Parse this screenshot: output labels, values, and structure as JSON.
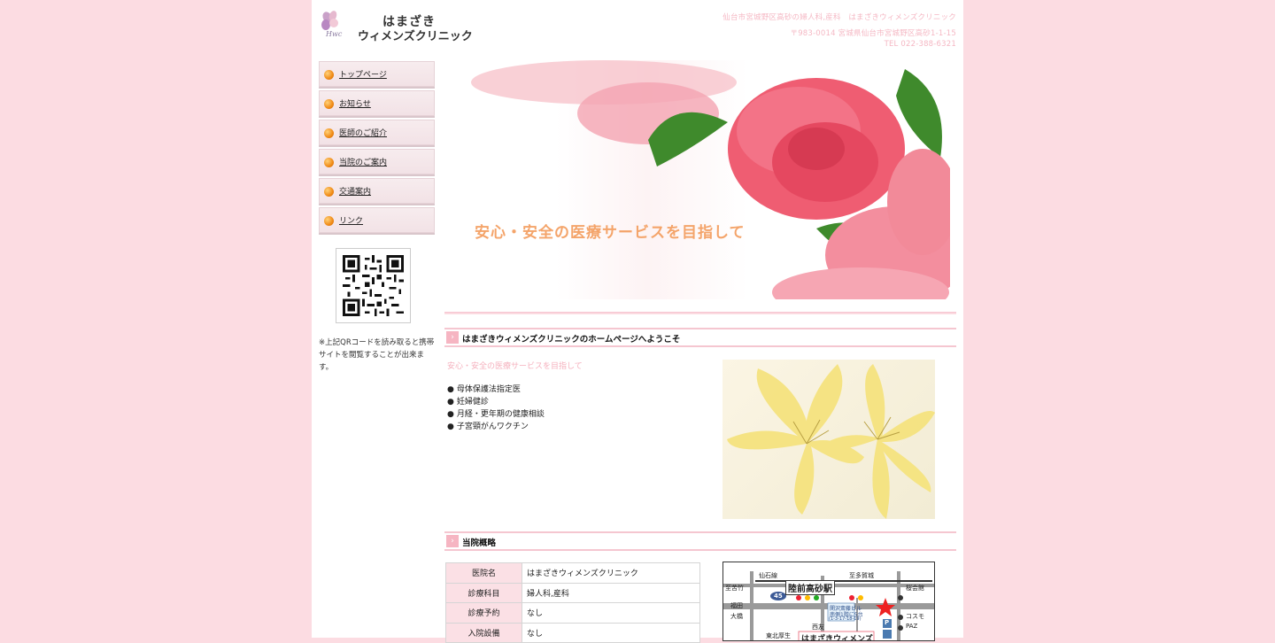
{
  "header": {
    "logo_line1": "はまざき",
    "logo_line2": "ウィメンズクリニック",
    "logo_script": "Hwc",
    "tagline": "仙台市宮城野区高砂の婦人科,産科　はまざきウィメンズクリニック",
    "address": "〒983-0014 宮城県仙台市宮城野区高砂1-1-15",
    "tel": "TEL 022-388-6321"
  },
  "nav": {
    "items": [
      {
        "label": "トップページ"
      },
      {
        "label": "お知らせ"
      },
      {
        "label": "医師のご紹介"
      },
      {
        "label": "当院のご案内"
      },
      {
        "label": "交通案内"
      },
      {
        "label": "リンク"
      }
    ]
  },
  "sidebar": {
    "qr_note": "※上記QRコードを読み取ると携帯サイトを閲覧することが出来ます。"
  },
  "hero": {
    "text": "安心・安全の医療サービスを目指して"
  },
  "welcome": {
    "title": "はまざきウィメンズクリニックのホームページへようこそ",
    "lead": "安心・安全の医療サービスを目指して",
    "bullet": "●",
    "services": [
      "母体保護法指定医",
      "妊婦健診",
      "月経・更年期の健康相談",
      "子宮頸がんワクチン"
    ]
  },
  "overview": {
    "title": "当院概略",
    "rows": [
      {
        "key": "医院名",
        "value": "はまざきウィメンズクリニック"
      },
      {
        "key": "診療科目",
        "value": "婦人科,産科"
      },
      {
        "key": "診療予約",
        "value": "なし"
      },
      {
        "key": "入院設備",
        "value": "なし"
      }
    ]
  },
  "map": {
    "line_label": "仙石線",
    "station": "陸前高砂駅",
    "to_tagajo": "至多賀城",
    "to_shiogama": "至苦竹",
    "fukuda": "福田",
    "ohashi": "大橋",
    "route": "45",
    "building": "関沢斎藤ビル",
    "building_sub": "南側1階に5台",
    "building_addr": "(1-3-17-18-19)",
    "sakura": "桜会館",
    "kosumo": "コスモ",
    "paz": "PAZ",
    "nishitomo": "西友",
    "higashikita": "東北厚生",
    "clinic": "はまざきウィメンズ",
    "parking": "P"
  },
  "colors": {
    "background": "#fcdce2",
    "accent_pink": "#f5b8c4",
    "hero_text": "#f4a46a",
    "nav_dot": "#f08a16",
    "table_key_bg": "#fbe0e5"
  },
  "icons": [
    "flower-logo-icon",
    "orange-dot-icon",
    "qr-code-icon",
    "section-arrow-icon",
    "star-marker-icon"
  ]
}
